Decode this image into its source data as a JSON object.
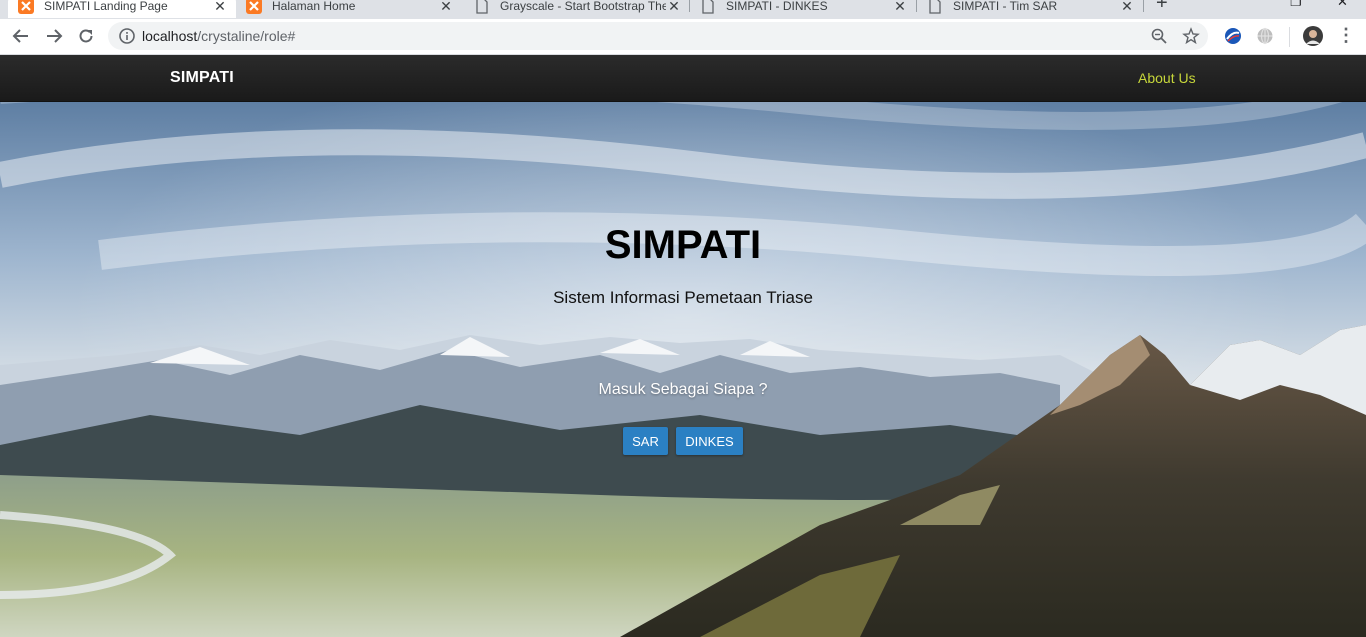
{
  "browser": {
    "tabs": [
      {
        "title": "SIMPATI Landing Page",
        "active": true,
        "icon": "xampp-icon"
      },
      {
        "title": "Halaman Home",
        "active": false,
        "icon": "xampp-icon"
      },
      {
        "title": "Grayscale - Start Bootstrap Theme",
        "active": false,
        "icon": "page-icon"
      },
      {
        "title": "SIMPATI - DINKES",
        "active": false,
        "icon": "page-icon"
      },
      {
        "title": "SIMPATI - Tim SAR",
        "active": false,
        "icon": "page-icon"
      }
    ],
    "url_host": "localhost",
    "url_path": "/crystaline/role#"
  },
  "navbar": {
    "brand": "SIMPATI",
    "about": "About Us"
  },
  "hero": {
    "title": "SIMPATI",
    "subtitle": "Sistem Informasi Pemetaan Triase",
    "question": "Masuk Sebagai Siapa ?",
    "buttons": [
      "SAR",
      "DINKES"
    ]
  },
  "colors": {
    "navbar_bg": "#222222",
    "about_link": "#c6d63a",
    "button_bg": "#2b80c3"
  }
}
